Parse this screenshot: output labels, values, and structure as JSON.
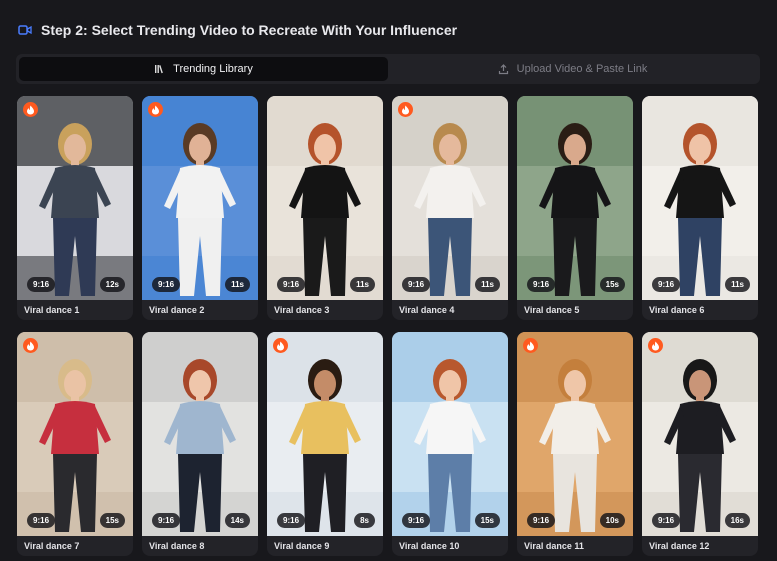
{
  "header": {
    "title": "Step 2: Select Trending Video to Recreate With Your Influencer",
    "icon": "video-camera-icon",
    "accent": "#4a7dff"
  },
  "tabs": [
    {
      "label": "Trending Library",
      "icon": "library-icon",
      "active": true
    },
    {
      "label": "Upload Video & Paste Link",
      "icon": "upload-icon",
      "active": false
    }
  ],
  "videos": [
    {
      "title": "Viral dance 1",
      "ratio": "9:16",
      "duration": "12s",
      "trending": true
    },
    {
      "title": "Viral dance 2",
      "ratio": "9:16",
      "duration": "11s",
      "trending": true
    },
    {
      "title": "Viral dance 3",
      "ratio": "9:16",
      "duration": "11s",
      "trending": false
    },
    {
      "title": "Viral dance 4",
      "ratio": "9:16",
      "duration": "11s",
      "trending": true
    },
    {
      "title": "Viral dance 5",
      "ratio": "9:16",
      "duration": "15s",
      "trending": false
    },
    {
      "title": "Viral dance 6",
      "ratio": "9:16",
      "duration": "11s",
      "trending": false
    },
    {
      "title": "Viral dance 7",
      "ratio": "9:16",
      "duration": "15s",
      "trending": true
    },
    {
      "title": "Viral dance 8",
      "ratio": "9:16",
      "duration": "14s",
      "trending": false
    },
    {
      "title": "Viral dance 9",
      "ratio": "9:16",
      "duration": "8s",
      "trending": true
    },
    {
      "title": "Viral dance 10",
      "ratio": "9:16",
      "duration": "15s",
      "trending": false
    },
    {
      "title": "Viral dance 11",
      "ratio": "9:16",
      "duration": "10s",
      "trending": true
    },
    {
      "title": "Viral dance 12",
      "ratio": "9:16",
      "duration": "16s",
      "trending": true
    }
  ],
  "colors": {
    "trending_badge": "#ff5a1f",
    "background": "#18181c"
  }
}
